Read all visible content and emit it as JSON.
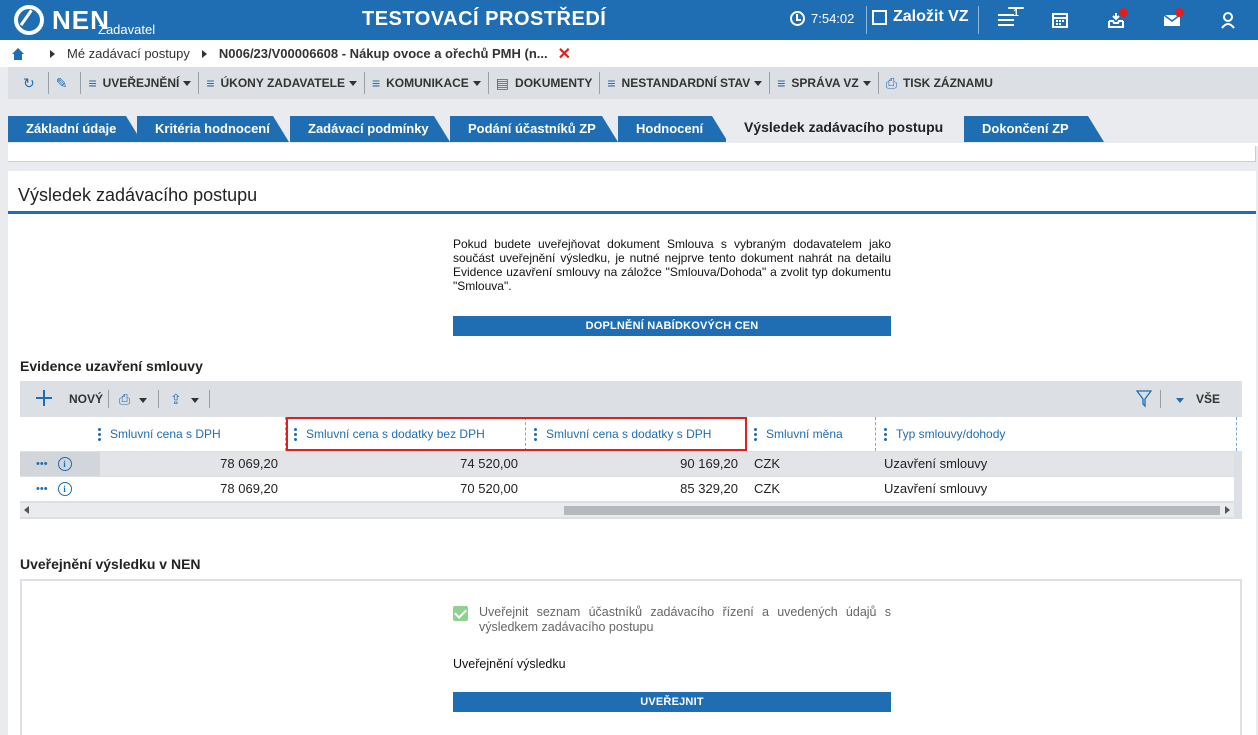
{
  "header": {
    "logo": "NEN",
    "logo_sub": "Zadavatel",
    "env_title": "TESTOVACÍ PROSTŘEDÍ",
    "time": "7:54:02",
    "create_vz": "Založit VZ",
    "menu_badge": "1"
  },
  "breadcrumb": {
    "items": [
      "Mé zadávací postupy",
      "N006/23/V00006608 - Nákup ovoce a ořechů PMH (n..."
    ]
  },
  "toolbar": {
    "items": [
      "UVEŘEJNĚNÍ",
      "ÚKONY ZADAVATELE",
      "KOMUNIKACE",
      "DOKUMENTY",
      "NESTANDARDNÍ STAV",
      "SPRÁVA VZ",
      "TISK ZÁZNAMU"
    ]
  },
  "tabs": [
    "Základní údaje",
    "Kritéria hodnocení",
    "Zadávací podmínky",
    "Podání účastníků ZP",
    "Hodnocení",
    "Výsledek zadávacího postupu",
    "Dokončení ZP"
  ],
  "main": {
    "title": "Výsledek zadávacího postupu",
    "notice": "Pokud budete uveřejňovat dokument Smlouva s vybraným dodavatelem jako součást uveřejnění výsledku, je nutné nejprve tento dokument nahrát na detailu Evidence uzavření smlouvy na záložce \"Smlouva/Dohoda\" a zvolit typ dokumentu \"Smlouva\".",
    "fill_prices_button": "DOPLNĚNÍ NABÍDKOVÝCH CEN"
  },
  "evidence": {
    "title": "Evidence uzavření smlouvy",
    "new_label": "NOVÝ",
    "all_label": "VŠE",
    "columns": [
      "Smluvní cena s DPH",
      "Smluvní cena s dodatky bez DPH",
      "Smluvní cena s dodatky s DPH",
      "Smluvní měna",
      "Typ smlouvy/dohody"
    ],
    "rows": [
      [
        "78 069,20",
        "74 520,00",
        "90 169,20",
        "CZK",
        "Uzavření smlouvy"
      ],
      [
        "78 069,20",
        "70 520,00",
        "85 329,20",
        "CZK",
        "Uzavření smlouvy"
      ]
    ]
  },
  "publish": {
    "title": "Uveřejnění výsledku v NEN",
    "checkbox_label": "Uveřejnit seznam účastníků zadávacího řízení a uvedených údajů s výsledkem zadávacího postupu",
    "checkbox_checked": true,
    "result_label": "Uveřejnění výsledku",
    "publish_button": "UVEŘEJNIT"
  },
  "colors": {
    "primary": "#1f6db2",
    "highlight": "#e02020",
    "checkbox": "#8fd28f"
  }
}
